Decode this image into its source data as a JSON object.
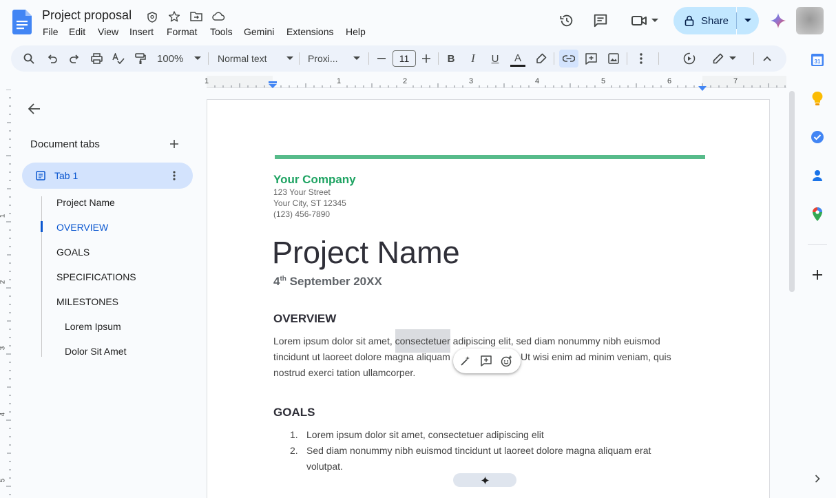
{
  "doc": {
    "title": "Project proposal",
    "menu": [
      "File",
      "Edit",
      "View",
      "Insert",
      "Format",
      "Tools",
      "Gemini",
      "Extensions",
      "Help"
    ],
    "share_label": "Share"
  },
  "toolbar": {
    "zoom": "100%",
    "style": "Normal text",
    "font": "Proxi...",
    "font_size": "11"
  },
  "ruler": {
    "numbers": [
      "1",
      "1",
      "2",
      "3",
      "4",
      "5",
      "6",
      "7"
    ]
  },
  "left_ruler": {
    "numbers": [
      "1",
      "2",
      "3",
      "4",
      "5"
    ]
  },
  "sidebar": {
    "heading": "Document tabs",
    "tab_label": "Tab 1",
    "outline": [
      {
        "label": "Project Name",
        "active": false,
        "level": 1
      },
      {
        "label": "OVERVIEW",
        "active": true,
        "level": 1
      },
      {
        "label": "GOALS",
        "active": false,
        "level": 1
      },
      {
        "label": "SPECIFICATIONS",
        "active": false,
        "level": 1
      },
      {
        "label": "MILESTONES",
        "active": false,
        "level": 1
      },
      {
        "label": "Lorem Ipsum",
        "active": false,
        "level": 2
      },
      {
        "label": "Dolor Sit Amet",
        "active": false,
        "level": 2
      }
    ]
  },
  "page": {
    "company": "Your Company",
    "street": "123 Your Street",
    "city": "Your City, ST 12345",
    "phone": "(123) 456-7890",
    "project_title": "Project Name",
    "date_day": "4",
    "date_suffix": "th",
    "date_rest": " September 20XX",
    "overview_heading": "OVERVIEW",
    "overview_line1_a": "Lorem ipsum dolor sit amet, ",
    "overview_line1_hl": "consectetuer",
    "overview_line1_b": " adipiscing elit, sed diam nonummy nibh euismod",
    "overview_line2_a": "tincidunt ut laoreet dolore magna aliquam",
    "overview_line2_b": "Ut wisi enim ad minim veniam, quis",
    "overview_line3": "nostrud exerci tation ullamcorper.",
    "goals_heading": "GOALS",
    "goals": [
      {
        "num": "1.",
        "lines": [
          "Lorem ipsum dolor sit amet, consectetuer adipiscing elit"
        ]
      },
      {
        "num": "2.",
        "lines": [
          "Sed diam nonummy nibh euismod tincidunt ut laoreet dolore magna aliquam erat",
          "volutpat."
        ]
      }
    ]
  },
  "colors": {
    "accent_green": "#34a853",
    "company_green": "#1ea362",
    "share_bg": "#c2e7ff",
    "tab_active_bg": "#d3e3fd",
    "link_blue": "#0b57d0"
  }
}
